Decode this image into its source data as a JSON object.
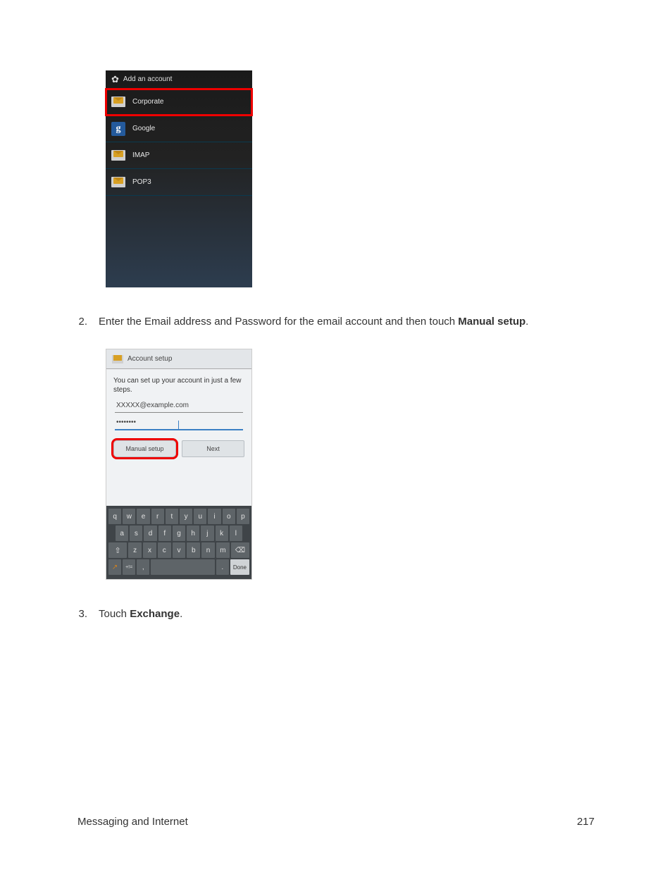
{
  "screenshot1": {
    "header": "Add an account",
    "rows": [
      {
        "label": "Corporate",
        "icon": "mail",
        "highlighted": true
      },
      {
        "label": "Google",
        "icon": "google",
        "highlighted": false
      },
      {
        "label": "IMAP",
        "icon": "mail",
        "highlighted": false
      },
      {
        "label": "POP3",
        "icon": "mail",
        "highlighted": false
      }
    ]
  },
  "step2": {
    "number": "2.",
    "prefix": "Enter the Email address and Password for the email account and then touch ",
    "bold": "Manual setup",
    "suffix": "."
  },
  "screenshot2": {
    "header": "Account setup",
    "instruction": "You can set up your account in just a few steps.",
    "email_value": "XXXXX@example.com",
    "password_value": "••••••••",
    "manual_btn": "Manual setup",
    "next_btn": "Next",
    "keyboard": {
      "row1": [
        "q",
        "w",
        "e",
        "r",
        "t",
        "y",
        "u",
        "i",
        "o",
        "p"
      ],
      "row2": [
        "a",
        "s",
        "d",
        "f",
        "g",
        "h",
        "j",
        "k",
        "l"
      ],
      "row3_shift": "⇧",
      "row3": [
        "z",
        "x",
        "c",
        "v",
        "b",
        "n",
        "m"
      ],
      "row3_backspace": "⌫",
      "row4_swype": "↗",
      "row4_sym": "+!=",
      "row4_comma": ",",
      "row4_space": " ",
      "row4_period": ".",
      "row4_done": "Done"
    }
  },
  "step3": {
    "number": "3.",
    "prefix": "Touch ",
    "bold": "Exchange",
    "suffix": "."
  },
  "footer": {
    "section": "Messaging and Internet",
    "page": "217"
  }
}
